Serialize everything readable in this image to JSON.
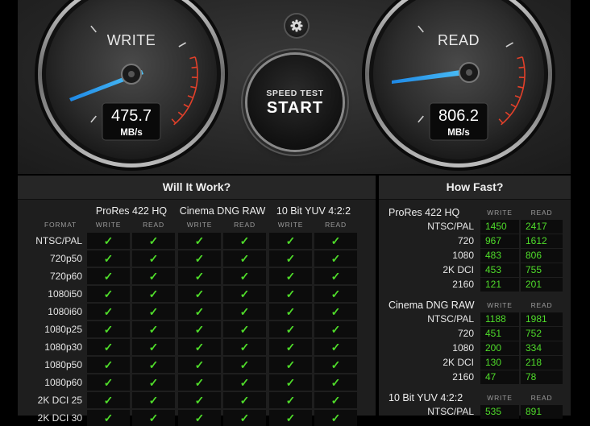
{
  "gauges": {
    "write": {
      "title": "WRITE",
      "value": "475.7",
      "unit": "MB/s"
    },
    "read": {
      "title": "READ",
      "value": "806.2",
      "unit": "MB/s"
    }
  },
  "start_button": {
    "line1": "SPEED TEST",
    "line2": "START"
  },
  "settings_icon": "gear-icon",
  "will_it_work": {
    "title": "Will It Work?",
    "format_label": "FORMAT",
    "write_label": "WRITE",
    "read_label": "READ",
    "check_mark": "✓",
    "codecs": [
      "ProRes 422 HQ",
      "Cinema DNG RAW",
      "10 Bit YUV 4:2:2"
    ],
    "formats": [
      "NTSC/PAL",
      "720p50",
      "720p60",
      "1080i50",
      "1080i60",
      "1080p25",
      "1080p30",
      "1080p50",
      "1080p60",
      "2K DCI 25",
      "2K DCI 30"
    ]
  },
  "how_fast": {
    "title": "How Fast?",
    "write_label": "WRITE",
    "read_label": "READ",
    "groups": [
      {
        "codec": "ProRes 422 HQ",
        "rows": [
          {
            "format": "NTSC/PAL",
            "write": "1450",
            "read": "2417"
          },
          {
            "format": "720",
            "write": "967",
            "read": "1612"
          },
          {
            "format": "1080",
            "write": "483",
            "read": "806"
          },
          {
            "format": "2K DCI",
            "write": "453",
            "read": "755"
          },
          {
            "format": "2160",
            "write": "121",
            "read": "201"
          }
        ]
      },
      {
        "codec": "Cinema DNG RAW",
        "rows": [
          {
            "format": "NTSC/PAL",
            "write": "1188",
            "read": "1981"
          },
          {
            "format": "720",
            "write": "451",
            "read": "752"
          },
          {
            "format": "1080",
            "write": "200",
            "read": "334"
          },
          {
            "format": "2K DCI",
            "write": "130",
            "read": "218"
          },
          {
            "format": "2160",
            "write": "47",
            "read": "78"
          }
        ]
      },
      {
        "codec": "10 Bit YUV 4:2:2",
        "rows": [
          {
            "format": "NTSC/PAL",
            "write": "535",
            "read": "891"
          }
        ]
      }
    ]
  },
  "colors": {
    "check": "#4fdc2a",
    "needle": "#29b6f6",
    "redline": "#e2402a"
  }
}
